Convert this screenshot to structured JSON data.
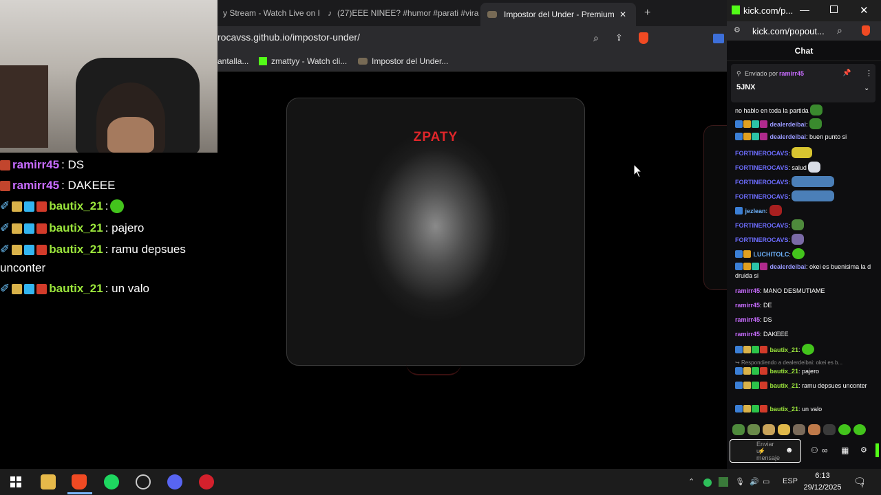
{
  "browser": {
    "tabs": [
      {
        "title": "y Stream - Watch Live on K",
        "active": false
      },
      {
        "title": "(27)EEE NINEE? #humor #parati #vira",
        "active": false
      },
      {
        "title": "Impostor del Under - Premium E",
        "active": true
      }
    ],
    "address": "rocavss.github.io/impostor-under/",
    "bookmarks": [
      "antalla...",
      "zmattyy - Watch cli...",
      "Impostor del Under..."
    ]
  },
  "overlay_chat": [
    {
      "user": "ramirr45",
      "text": ": DS"
    },
    {
      "user": "ramirr45",
      "text": ": DAKEEE"
    },
    {
      "user": "bautix_21",
      "text": ": "
    },
    {
      "user": "bautix_21",
      "text": ": pajero"
    },
    {
      "user": "bautix_21",
      "text": ": ramu depsues"
    },
    {
      "user": "",
      "text": "unconter"
    },
    {
      "user": "bautix_21",
      "text": ": un valo"
    }
  ],
  "game": {
    "logo": "ZPATY"
  },
  "kick": {
    "window_title": "kick.com/p...",
    "address": "kick.com/popout...",
    "chat_title": "Chat",
    "pinned": {
      "sent_by_prefix": "Enviado por",
      "sent_by_user": "ramirr45",
      "text": "5JNX"
    },
    "messages": [
      {
        "user": "",
        "text": "no hablo en toda la partida"
      },
      {
        "user": "dealerdeibai",
        "text": ":"
      },
      {
        "user": "dealerdeibai",
        "text": ": buen punto si"
      },
      {
        "user": "FORTINEROCAVS",
        "text": ":"
      },
      {
        "user": "FORTINEROCAVS",
        "text": ": salud"
      },
      {
        "user": "FORTINEROCAVS",
        "text": ":"
      },
      {
        "user": "FORTINEROCAVS",
        "text": ":"
      },
      {
        "user": "jezlean",
        "text": ":"
      },
      {
        "user": "FORTINEROCAVS",
        "text": ":"
      },
      {
        "user": "FORTINEROCAVS",
        "text": ":"
      },
      {
        "user": "LUCHITOLC",
        "text": ":"
      },
      {
        "user": "dealerdeibai",
        "text": ": okei es buenisima la d druida si"
      },
      {
        "user": "ramirr45",
        "text": ": MANO DESMUTIAME"
      },
      {
        "user": "ramirr45",
        "text": ": DE"
      },
      {
        "user": "ramirr45",
        "text": ": DS"
      },
      {
        "user": "ramirr45",
        "text": ": DAKEEE"
      },
      {
        "user": "bautix_21",
        "text": ":"
      },
      {
        "user": "",
        "text": "Respondiendo a dealerdeibai: okei es b..."
      },
      {
        "user": "bautix_21",
        "text": ": pajero"
      },
      {
        "user": "bautix_21",
        "text": ": ramu depsues unconter"
      },
      {
        "user": "bautix_21",
        "text": ": un valo"
      }
    ],
    "input_placeholder": "Enviar un mensaje"
  },
  "taskbar": {
    "language": "ESP",
    "time": "6:13",
    "date": "29/12/2025",
    "notifications": "7"
  },
  "colors": {
    "kick_green": "#53fc18",
    "logo_red": "#e0262a",
    "fortinero": "#6d6dff",
    "ramirr": "#c86cff",
    "bautix": "#9be63c",
    "dealer": "#9a9aff"
  }
}
